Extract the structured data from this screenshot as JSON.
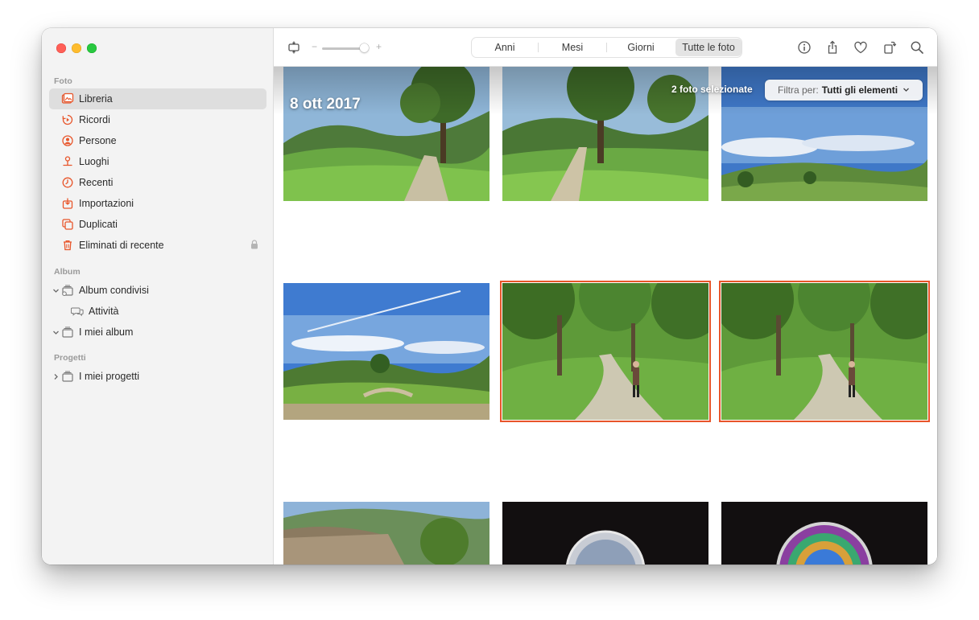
{
  "sidebar": {
    "sections": {
      "foto": "Foto",
      "album": "Album",
      "progetti": "Progetti"
    },
    "foto_items": [
      {
        "label": "Libreria",
        "icon": "photo-library-icon",
        "selected": true
      },
      {
        "label": "Ricordi",
        "icon": "memories-icon"
      },
      {
        "label": "Persone",
        "icon": "people-icon"
      },
      {
        "label": "Luoghi",
        "icon": "places-pin-icon"
      },
      {
        "label": "Recenti",
        "icon": "recents-clock-icon"
      },
      {
        "label": "Importazioni",
        "icon": "imports-icon"
      },
      {
        "label": "Duplicati",
        "icon": "duplicates-icon"
      },
      {
        "label": "Eliminati di recente",
        "icon": "trash-icon",
        "locked": true
      }
    ],
    "album_items": [
      {
        "label": "Album condivisi",
        "icon": "shared-album-icon",
        "expanded": true
      },
      {
        "label": "Attività",
        "icon": "activity-bubble-icon"
      },
      {
        "label": "I miei album",
        "icon": "my-albums-icon",
        "expanded": true
      }
    ],
    "progetti_items": [
      {
        "label": "I miei progetti",
        "icon": "projects-icon",
        "expanded": false
      }
    ]
  },
  "toolbar": {
    "zoom_minus": "−",
    "zoom_plus": "+",
    "zoom_level": 0.85,
    "tabs": [
      "Anni",
      "Mesi",
      "Giorni",
      "Tutte le foto"
    ],
    "active_tab": "Tutte le foto",
    "icons": [
      "info-icon",
      "share-icon",
      "heart-icon",
      "rotate-icon",
      "search-icon"
    ]
  },
  "grid": {
    "date_label": "8 ott 2017",
    "selection_count": "2 foto selezionate",
    "filter_prefix": "Filtra per:",
    "filter_value": "Tutti gli elementi"
  },
  "colors": {
    "accent": "#e8552a",
    "sidebar_bg": "#f3f3f3",
    "selected_bg": "#dedede"
  }
}
